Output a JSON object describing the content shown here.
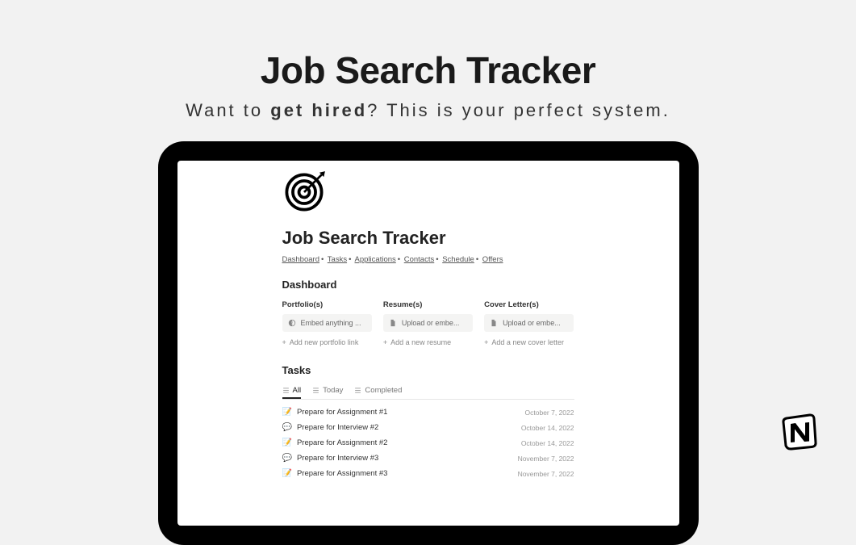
{
  "hero": {
    "title": "Job Search Tracker",
    "subtitle_pre": "Want to ",
    "subtitle_bold": "get hired",
    "subtitle_post": "? This is your perfect system."
  },
  "page": {
    "title": "Job Search Tracker",
    "breadcrumb": [
      "Dashboard",
      "Tasks",
      "Applications",
      "Contacts",
      "Schedule",
      "Offers"
    ]
  },
  "dashboard": {
    "heading": "Dashboard",
    "columns": [
      {
        "label": "Portfolio(s)",
        "placeholder": "Embed anything ...",
        "add": "Add new portfolio link",
        "icon": "embed"
      },
      {
        "label": "Resume(s)",
        "placeholder": "Upload or embe...",
        "add": "Add a new resume",
        "icon": "file"
      },
      {
        "label": "Cover Letter(s)",
        "placeholder": "Upload or embe...",
        "add": "Add a new cover letter",
        "icon": "file"
      }
    ]
  },
  "tasks": {
    "heading": "Tasks",
    "tabs": [
      {
        "label": "All",
        "active": true
      },
      {
        "label": "Today",
        "active": false
      },
      {
        "label": "Completed",
        "active": false
      }
    ],
    "rows": [
      {
        "emoji": "📝",
        "title": "Prepare for Assignment #1",
        "date": "October 7, 2022"
      },
      {
        "emoji": "💬",
        "title": "Prepare for Interview #2",
        "date": "October 14, 2022"
      },
      {
        "emoji": "📝",
        "title": "Prepare for Assignment #2",
        "date": "October 14, 2022"
      },
      {
        "emoji": "💬",
        "title": "Prepare for Interview #3",
        "date": "November 7, 2022"
      },
      {
        "emoji": "📝",
        "title": "Prepare for Assignment #3",
        "date": "November 7, 2022"
      }
    ]
  }
}
